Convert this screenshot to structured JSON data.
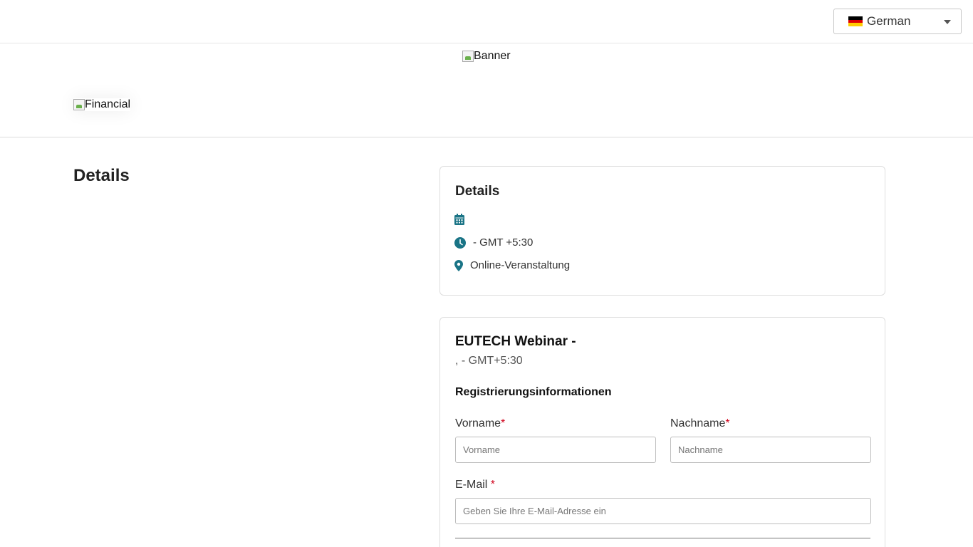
{
  "header": {
    "language": "German",
    "flag_colors": [
      "#000000",
      "#dd0000",
      "#ffcc00"
    ]
  },
  "hero": {
    "banner_alt": "Banner",
    "logo_alt": "Financial"
  },
  "left": {
    "title": "Details"
  },
  "details_card": {
    "title": "Details",
    "date": "",
    "time": "- GMT +5:30",
    "location": "Online-Veranstaltung",
    "icon_color": "#1a7486"
  },
  "form_card": {
    "title": "EUTECH Webinar -",
    "subtitle": ", - GMT+5:30",
    "section_title": "Registrierungsinformationen",
    "first_name": {
      "label": "Vorname",
      "required_mark": "*",
      "placeholder": "Vorname",
      "value": ""
    },
    "last_name": {
      "label": "Nachname",
      "required_mark": "*",
      "placeholder": "Nachname",
      "value": ""
    },
    "email": {
      "label": "E-Mail ",
      "required_mark": "*",
      "placeholder": "Geben Sie Ihre E-Mail-Adresse ein",
      "value": ""
    }
  }
}
